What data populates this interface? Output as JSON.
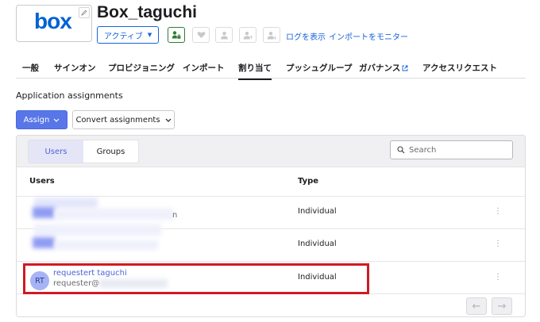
{
  "header": {
    "logo_text": "box",
    "app_title": "Box_taguchi",
    "status_label": "アクティブ",
    "log_link": "ログを表示",
    "import_link": "インポートをモニター",
    "icons": [
      "pencil-icon",
      "lock-user-icon",
      "heart-icon",
      "user-icon",
      "user-upload-icon",
      "user-download-icon"
    ]
  },
  "tabs": [
    {
      "label": "一般",
      "active": false
    },
    {
      "label": "サインオン",
      "active": false
    },
    {
      "label": "プロビジョニング",
      "active": false
    },
    {
      "label": "インポート",
      "active": false
    },
    {
      "label": "割り当て",
      "active": true
    },
    {
      "label": "プッシュグループ",
      "active": false
    },
    {
      "label": "ガバナンス",
      "active": false
    },
    {
      "label": "アクセスリクエスト",
      "active": false
    }
  ],
  "section": {
    "title": "Application assignments",
    "assign_label": "Assign",
    "convert_label": "Convert assignments"
  },
  "panel": {
    "seg_users": "Users",
    "seg_groups": "Groups",
    "search_placeholder": "Search",
    "col_users": "Users",
    "col_type": "Type",
    "rows": [
      {
        "type": "Individual",
        "name": "",
        "email": "",
        "email_partial": "n",
        "redacted": true
      },
      {
        "type": "Individual",
        "name": "",
        "email": "",
        "redacted": true
      },
      {
        "initials": "RT",
        "name": "requestert taguchi",
        "email": "requester@",
        "type": "Individual",
        "redacted": false
      }
    ],
    "kebab": "⋮",
    "prev_label": "←",
    "next_label": "→"
  },
  "colors": {
    "accent": "#1662dd",
    "assign_bg": "#5876e8",
    "highlight": "#d01a24",
    "avatar_bg": "#a6b4f6"
  }
}
